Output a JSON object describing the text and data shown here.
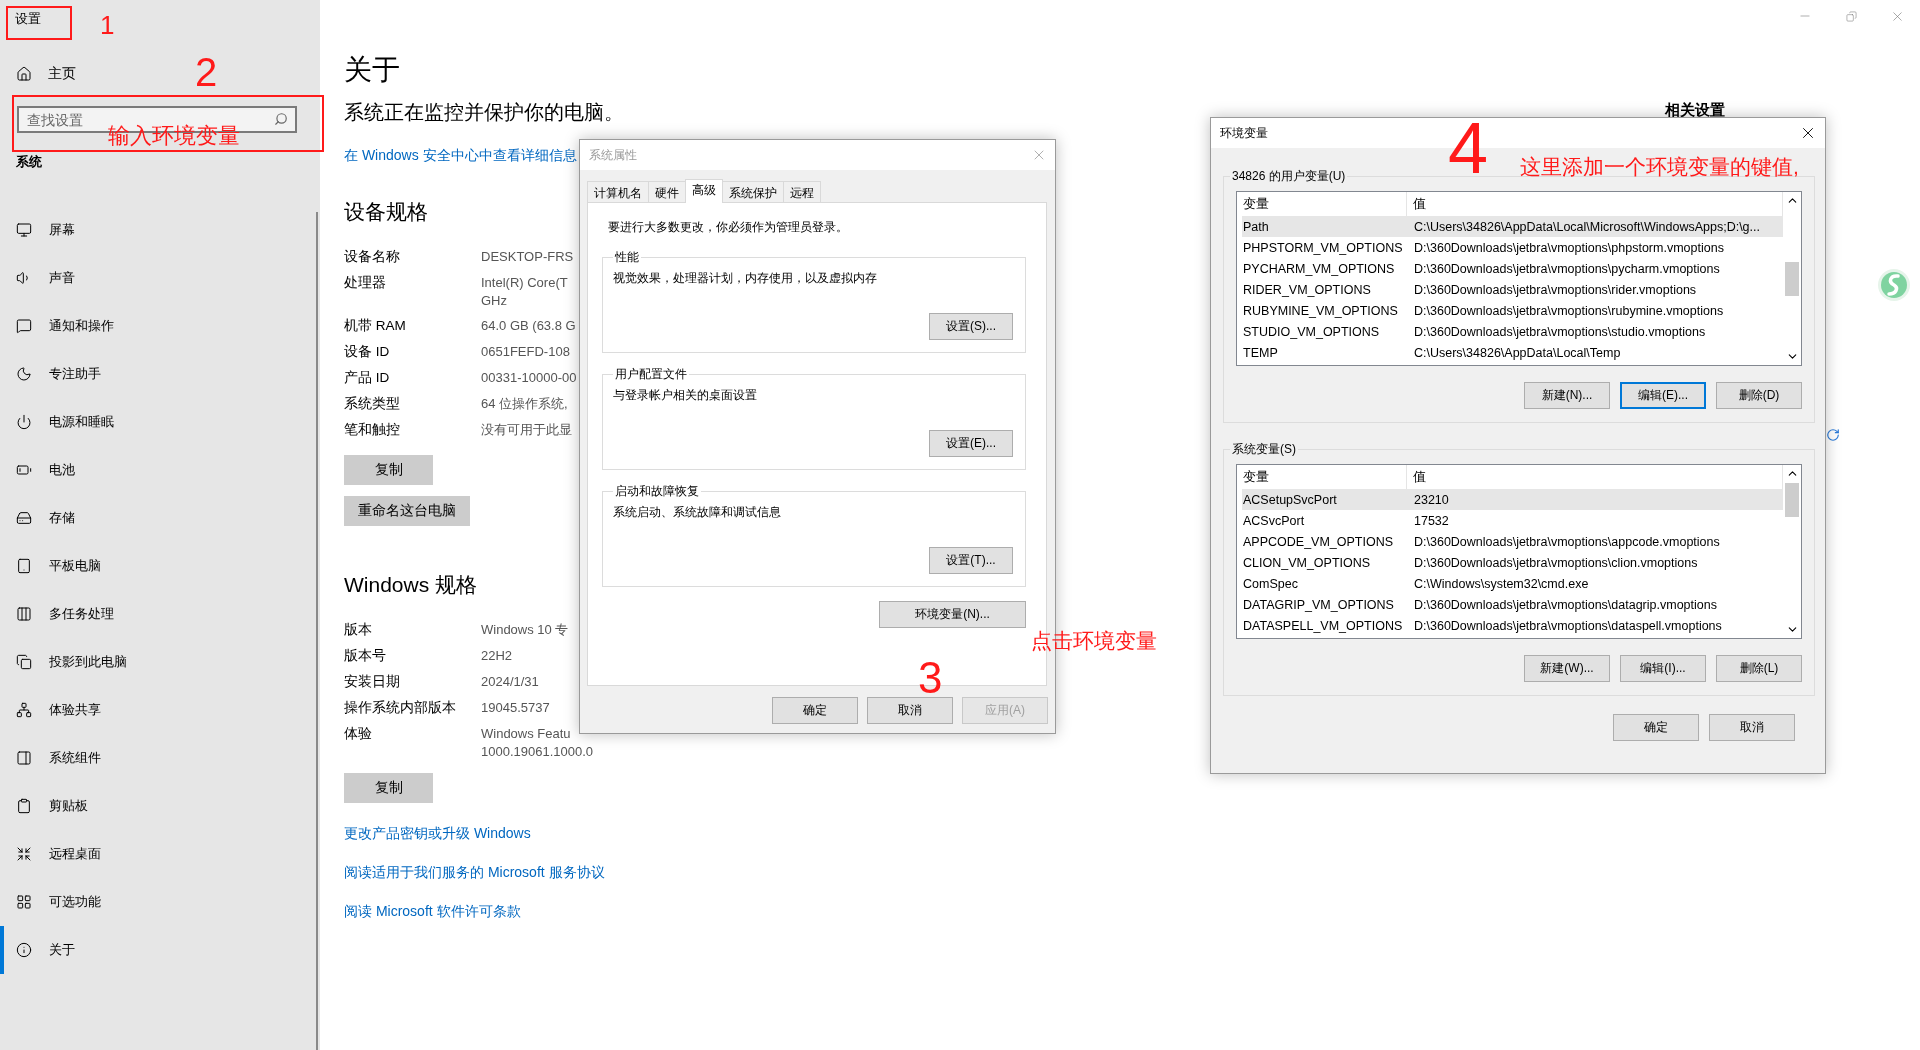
{
  "settings": {
    "title": "设置",
    "home": "主页",
    "search": {
      "placeholder": "查找设置"
    },
    "section": "系统",
    "nav": [
      {
        "label": "屏幕",
        "selected": false
      },
      {
        "label": "声音",
        "selected": false
      },
      {
        "label": "通知和操作",
        "selected": false
      },
      {
        "label": "专注助手",
        "selected": false
      },
      {
        "label": "电源和睡眠",
        "selected": false
      },
      {
        "label": "电池",
        "selected": false
      },
      {
        "label": "存储",
        "selected": false
      },
      {
        "label": "平板电脑",
        "selected": false
      },
      {
        "label": "多任务处理",
        "selected": false
      },
      {
        "label": "投影到此电脑",
        "selected": false
      },
      {
        "label": "体验共享",
        "selected": false
      },
      {
        "label": "系统组件",
        "selected": false
      },
      {
        "label": "剪贴板",
        "selected": false
      },
      {
        "label": "远程桌面",
        "selected": false
      },
      {
        "label": "可选功能",
        "selected": false
      },
      {
        "label": "关于",
        "selected": true
      }
    ]
  },
  "about": {
    "title": "关于",
    "protection": "系统正在监控并保护你的电脑。",
    "security_link": "在 Windows 安全中心中查看详细信息",
    "device_heading": "设备规格",
    "device_specs": [
      {
        "label": "设备名称",
        "value": [
          "DESKTOP-FRS"
        ]
      },
      {
        "label": "处理器",
        "value": [
          "Intel(R) Core(T",
          "GHz"
        ]
      },
      {
        "label": "机带 RAM",
        "value": [
          "64.0 GB (63.8 G"
        ]
      },
      {
        "label": "设备 ID",
        "value": [
          "0651FEFD-108"
        ]
      },
      {
        "label": "产品 ID",
        "value": [
          "00331-10000-00"
        ]
      },
      {
        "label": "系统类型",
        "value": [
          "64 位操作系统,"
        ]
      },
      {
        "label": "笔和触控",
        "value": [
          "没有可用于此显"
        ]
      }
    ],
    "copy_button": "复制",
    "rename_button": "重命名这台电脑",
    "windows_heading": "Windows 规格",
    "windows_specs": [
      {
        "label": "版本",
        "value": [
          "Windows 10 专"
        ]
      },
      {
        "label": "版本号",
        "value": [
          "22H2"
        ]
      },
      {
        "label": "安装日期",
        "value": [
          "2024/1/31"
        ]
      },
      {
        "label": "操作系统内部版本",
        "value": [
          "19045.5737"
        ]
      },
      {
        "label": "体验",
        "value": [
          "Windows Featu",
          "1000.19061.1000.0"
        ]
      }
    ],
    "copy_button_2": "复制",
    "links": [
      "更改产品密钥或升级 Windows",
      "阅读适用于我们服务的 Microsoft 服务协议",
      "阅读 Microsoft 软件许可条款"
    ],
    "related_settings": "相关设置"
  },
  "system_properties": {
    "title": "系统属性",
    "active": false,
    "tabs": [
      {
        "label": "计算机名",
        "selected": false
      },
      {
        "label": "硬件",
        "selected": false
      },
      {
        "label": "高级",
        "selected": true
      },
      {
        "label": "系统保护",
        "selected": false
      },
      {
        "label": "远程",
        "selected": false
      }
    ],
    "admin_note": "要进行大多数更改，你必须作为管理员登录。",
    "groups": [
      {
        "label": "性能",
        "description": "视觉效果，处理器计划，内存使用，以及虚拟内存",
        "button": "设置(S)..."
      },
      {
        "label": "用户配置文件",
        "description": "与登录帐户相关的桌面设置",
        "button": "设置(E)..."
      },
      {
        "label": "启动和故障恢复",
        "description": "系统启动、系统故障和调试信息",
        "button": "设置(T)..."
      }
    ],
    "env_button": "环境变量(N)...",
    "buttons": [
      {
        "label": "确定",
        "disabled": false
      },
      {
        "label": "取消",
        "disabled": false
      },
      {
        "label": "应用(A)",
        "disabled": true
      }
    ]
  },
  "env_dialog": {
    "title": "环境变量",
    "active": true,
    "user_vars": {
      "label": "34826 的用户变量(U)",
      "columns": [
        "变量",
        "值"
      ],
      "rows": [
        {
          "name": "Path",
          "value": "C:\\Users\\34826\\AppData\\Local\\Microsoft\\WindowsApps;D:\\g...",
          "selected": true
        },
        {
          "name": "PHPSTORM_VM_OPTIONS",
          "value": "D:\\360Downloads\\jetbra\\vmoptions\\phpstorm.vmoptions",
          "selected": false
        },
        {
          "name": "PYCHARM_VM_OPTIONS",
          "value": "D:\\360Downloads\\jetbra\\vmoptions\\pycharm.vmoptions",
          "selected": false
        },
        {
          "name": "RIDER_VM_OPTIONS",
          "value": "D:\\360Downloads\\jetbra\\vmoptions\\rider.vmoptions",
          "selected": false
        },
        {
          "name": "RUBYMINE_VM_OPTIONS",
          "value": "D:\\360Downloads\\jetbra\\vmoptions\\rubymine.vmoptions",
          "selected": false
        },
        {
          "name": "STUDIO_VM_OPTIONS",
          "value": "D:\\360Downloads\\jetbra\\vmoptions\\studio.vmoptions",
          "selected": false
        },
        {
          "name": "TEMP",
          "value": "C:\\Users\\34826\\AppData\\Local\\Temp",
          "selected": false
        }
      ],
      "buttons": [
        {
          "label": "新建(N)...",
          "focused": false
        },
        {
          "label": "编辑(E)...",
          "focused": true
        },
        {
          "label": "删除(D)",
          "focused": false
        }
      ]
    },
    "system_vars": {
      "label": "系统变量(S)",
      "columns": [
        "变量",
        "值"
      ],
      "rows": [
        {
          "name": "ACSetupSvcPort",
          "value": "23210",
          "selected": true
        },
        {
          "name": "ACSvcPort",
          "value": "17532",
          "selected": false
        },
        {
          "name": "APPCODE_VM_OPTIONS",
          "value": "D:\\360Downloads\\jetbra\\vmoptions\\appcode.vmoptions",
          "selected": false
        },
        {
          "name": "CLION_VM_OPTIONS",
          "value": "D:\\360Downloads\\jetbra\\vmoptions\\clion.vmoptions",
          "selected": false
        },
        {
          "name": "ComSpec",
          "value": "C:\\Windows\\system32\\cmd.exe",
          "selected": false
        },
        {
          "name": "DATAGRIP_VM_OPTIONS",
          "value": "D:\\360Downloads\\jetbra\\vmoptions\\datagrip.vmoptions",
          "selected": false
        },
        {
          "name": "DATASPELL_VM_OPTIONS",
          "value": "D:\\360Downloads\\jetbra\\vmoptions\\dataspell.vmoptions",
          "selected": false
        }
      ],
      "buttons": [
        {
          "label": "新建(W)...",
          "focused": false
        },
        {
          "label": "编辑(I)...",
          "focused": false
        },
        {
          "label": "删除(L)",
          "focused": false
        }
      ]
    },
    "buttons": [
      {
        "label": "确定",
        "focused": false
      },
      {
        "label": "取消",
        "focused": false
      }
    ]
  },
  "annotations": {
    "step_1": "1",
    "step_2": "2",
    "search_hint": "输入环境变量",
    "step_3": "3",
    "click_hint": "点击环境变量",
    "step_4": "4",
    "add_hint": "这里添加一个环境变量的键值,"
  }
}
